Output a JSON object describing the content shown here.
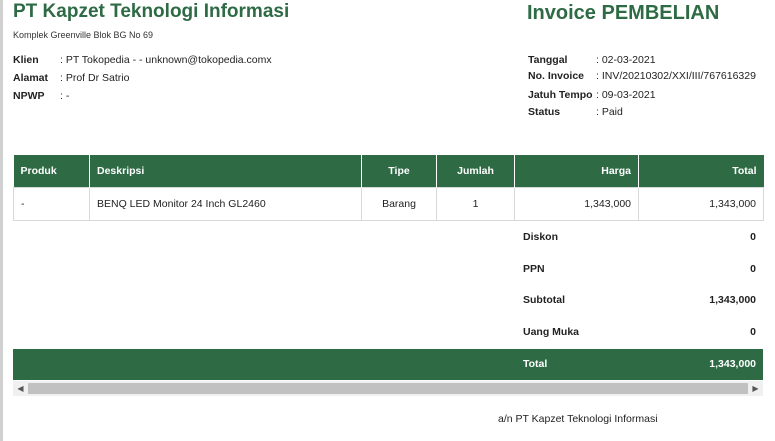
{
  "company": {
    "name": "PT Kapzet Teknologi Informasi",
    "address": "Komplek Greenville Blok BG No 69"
  },
  "invoice_title": "Invoice PEMBELIAN",
  "client": [
    {
      "label": "Klien",
      "value": ": PT Tokopedia - - unknown@tokopedia.comx"
    },
    {
      "label": "Alamat",
      "value": ": Prof Dr Satrio"
    },
    {
      "label": "NPWP",
      "value": ": -"
    }
  ],
  "meta": [
    {
      "label": "Tanggal",
      "value": ": 02-03-2021"
    },
    {
      "label": "No. Invoice",
      "value": ": INV/20210302/XXI/III/767616329"
    },
    {
      "label": "Jatuh Tempo",
      "value": ": 09-03-2021"
    },
    {
      "label": "Status",
      "value": ": Paid"
    }
  ],
  "table": {
    "headers": [
      "Produk",
      "Deskripsi",
      "Tipe",
      "Jumlah",
      "Harga",
      "Total"
    ],
    "rows": [
      [
        "-",
        "BENQ LED Monitor 24 Inch GL2460",
        "Barang",
        "1",
        "1,343,000",
        "1,343,000"
      ]
    ]
  },
  "summary": [
    {
      "label": "Diskon",
      "value": "0"
    },
    {
      "label": "PPN",
      "value": "0"
    },
    {
      "label": "Subtotal",
      "value": "1,343,000"
    },
    {
      "label": "Uang Muka",
      "value": "0"
    }
  ],
  "total": {
    "label": "Total",
    "value": "1,343,000"
  },
  "scroll": {
    "left_arrow": "◀",
    "right_arrow": "▶"
  },
  "signature": "a/n PT Kapzet Teknologi Informasi"
}
